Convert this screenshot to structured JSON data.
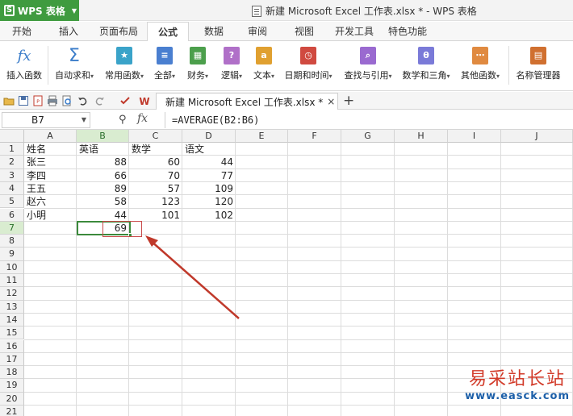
{
  "app": {
    "label": "WPS 表格",
    "logo_glyph": "S"
  },
  "window": {
    "title": "新建 Microsoft Excel 工作表.xlsx * - WPS 表格"
  },
  "ribbon_tabs": [
    {
      "label": "开始"
    },
    {
      "label": "插入"
    },
    {
      "label": "页面布局"
    },
    {
      "label": "公式",
      "active": true
    },
    {
      "label": "数据"
    },
    {
      "label": "审阅"
    },
    {
      "label": "视图"
    },
    {
      "label": "开发工具"
    },
    {
      "label": "特色功能"
    }
  ],
  "ribbon_buttons": [
    {
      "label": "插入函数",
      "icon": "fx-icon",
      "glyph": "fx",
      "color": "#3a7cc9"
    },
    {
      "label": "自动求和",
      "icon": "sigma-icon",
      "glyph": "Σ",
      "color": "#3a7cc9"
    },
    {
      "label": "常用函数",
      "icon": "star-book-icon",
      "glyph": "★",
      "color": "#3aa3c9"
    },
    {
      "label": "全部",
      "icon": "list-book-icon",
      "glyph": "≡",
      "color": "#4a7fd0"
    },
    {
      "label": "财务",
      "icon": "finance-book-icon",
      "glyph": "▦",
      "color": "#4c9f4c"
    },
    {
      "label": "逻辑",
      "icon": "logic-book-icon",
      "glyph": "?",
      "color": "#b070c8"
    },
    {
      "label": "文本",
      "icon": "text-book-icon",
      "glyph": "a",
      "color": "#e0a030"
    },
    {
      "label": "日期和时间",
      "icon": "clock-book-icon",
      "glyph": "◷",
      "color": "#d04a40"
    },
    {
      "label": "查找与引用",
      "icon": "search-book-icon",
      "glyph": "⌕",
      "color": "#9a6ad0"
    },
    {
      "label": "数学和三角",
      "icon": "math-book-icon",
      "glyph": "θ",
      "color": "#7a7ad8"
    },
    {
      "label": "其他函数",
      "icon": "other-book-icon",
      "glyph": "⋯",
      "color": "#e08a40"
    },
    {
      "label": "名称管理器",
      "icon": "name-manager-icon",
      "glyph": "▤",
      "color": "#d07030"
    }
  ],
  "file_tab": {
    "label": "新建 Microsoft Excel 工作表.xlsx *",
    "close": "×"
  },
  "formula_bar": {
    "name_box": "B7",
    "fx": "fx",
    "formula": "=AVERAGE(B2:B6)"
  },
  "columns": [
    "A",
    "B",
    "C",
    "D",
    "E",
    "F",
    "G",
    "H",
    "I",
    "J"
  ],
  "rows": [
    "1",
    "2",
    "3",
    "4",
    "5",
    "6",
    "7",
    "8",
    "9",
    "10",
    "11",
    "12",
    "13",
    "14",
    "15",
    "16",
    "17",
    "18",
    "19",
    "20",
    "21"
  ],
  "sheet": {
    "header": [
      "姓名",
      "英语",
      "数学",
      "语文"
    ],
    "data": [
      [
        "张三",
        "88",
        "60",
        "44"
      ],
      [
        "李四",
        "66",
        "70",
        "77"
      ],
      [
        "王五",
        "89",
        "57",
        "109"
      ],
      [
        "赵六",
        "58",
        "123",
        "120"
      ],
      [
        "小明",
        "44",
        "101",
        "102"
      ]
    ],
    "result": "69"
  },
  "watermark": {
    "text": "易采站长站",
    "url": "www.easck.com"
  }
}
